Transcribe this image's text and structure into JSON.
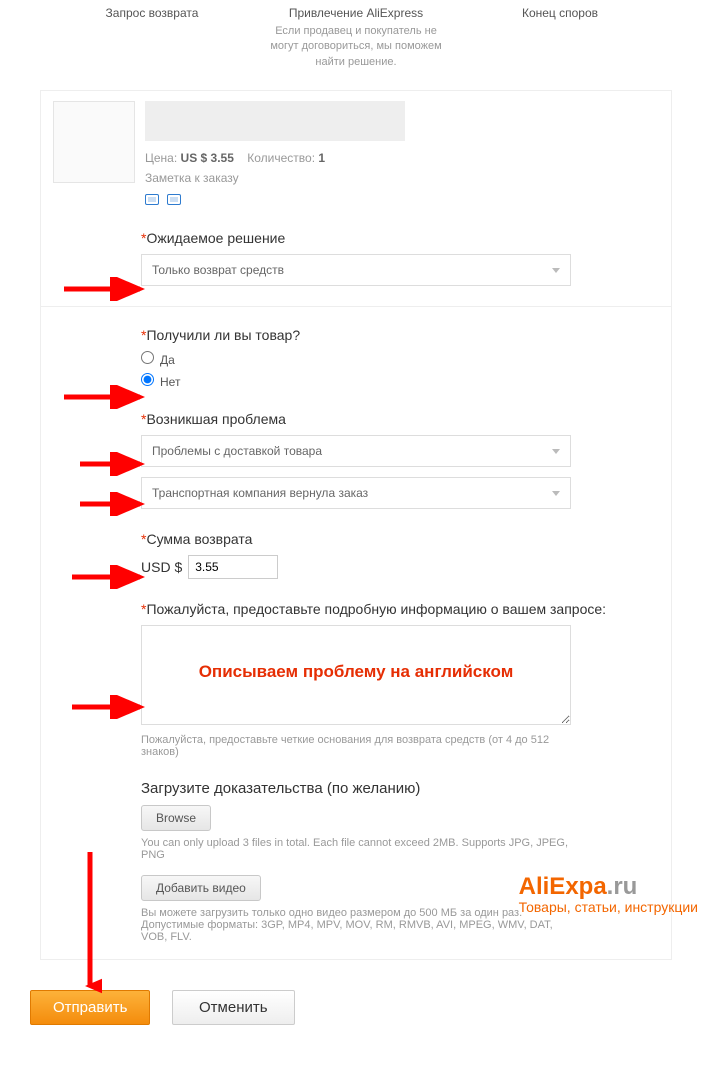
{
  "steps": {
    "s1": {
      "title": "Запрос возврата"
    },
    "s2": {
      "title": "Привлечение AliExpress",
      "sub": "Если продавец и покупатель не могут договориться, мы поможем найти решение."
    },
    "s3": {
      "title": "Конец споров"
    }
  },
  "product": {
    "price_label": "Цена:",
    "price_value": "US $ 3.55",
    "qty_label": "Количество:",
    "qty_value": "1",
    "note": "Заметка к заказу"
  },
  "form": {
    "expected": {
      "label": "Ожидаемое решение",
      "value": "Только возврат средств"
    },
    "received": {
      "label": "Получили ли вы товар?",
      "yes": "Да",
      "no": "Нет"
    },
    "problem": {
      "label": "Возникшая проблема",
      "sel1": "Проблемы с доставкой товара",
      "sel2": "Транспортная компания вернула заказ"
    },
    "refund": {
      "label": "Сумма возврата",
      "currency": "USD $",
      "value": "3.55"
    },
    "detail": {
      "label": "Пожалуйста, предоставьте подробную информацию о вашем запросе:",
      "overlay": "Описываем проблему на английском",
      "hint": "Пожалуйста, предоставьте четкие основания для возврата средств (от 4 до 512 знаков)"
    },
    "evidence": {
      "label": "Загрузите доказательства (по желанию)",
      "browse": "Browse",
      "hint": "You can only upload 3 files in total. Each file cannot exceed 2MB. Supports JPG, JPEG, PNG"
    },
    "video": {
      "button": "Добавить видео",
      "hint": "Вы можете загрузить только одно видео размером до 500 МБ за один раз. Допустимые форматы: 3GP, MP4, MPV, MOV, RM, RMVB, AVI, MPEG, WMV, DAT, VOB, FLV."
    },
    "submit": "Отправить",
    "cancel": "Отменить"
  },
  "watermark": {
    "main_a": "AliExpa",
    "main_b": ".ru",
    "sub": "Товары, статьи, инструкции"
  }
}
